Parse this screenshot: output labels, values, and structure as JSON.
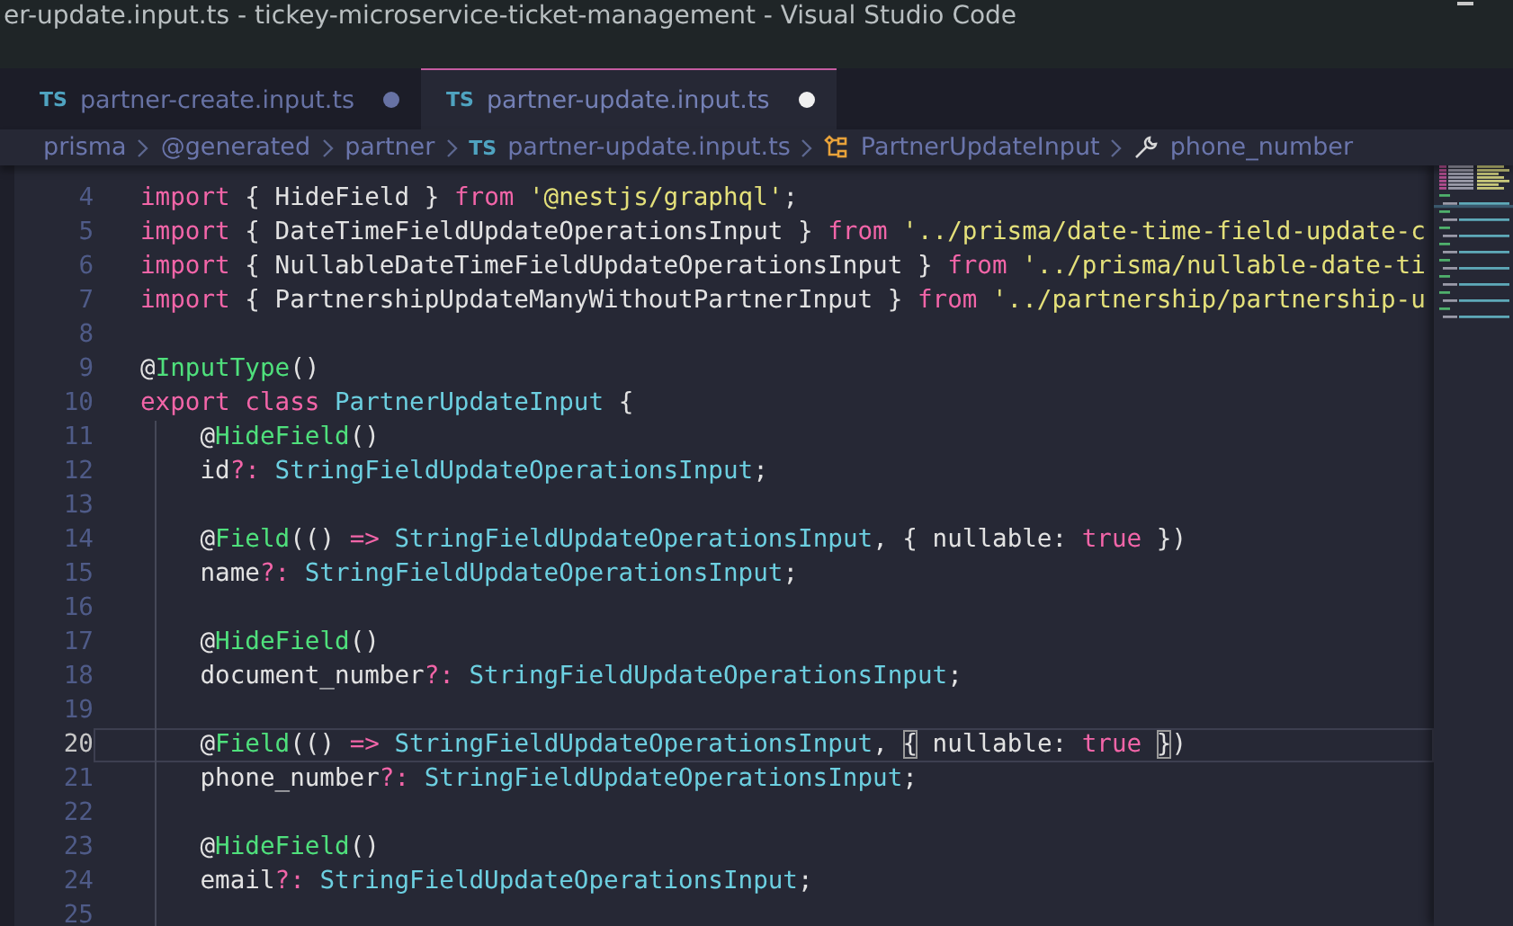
{
  "window": {
    "title": "er-update.input.ts - tickey-microservice-ticket-management - Visual Studio Code"
  },
  "tabs": [
    {
      "label": "partner-create.input.ts",
      "badge": "TS",
      "selected": false,
      "modified": true
    },
    {
      "label": "partner-update.input.ts",
      "badge": "TS",
      "selected": true,
      "modified": true
    }
  ],
  "breadcrumbs": [
    {
      "kind": "folder",
      "label": "prisma"
    },
    {
      "kind": "folder",
      "label": "@generated"
    },
    {
      "kind": "folder",
      "label": "partner"
    },
    {
      "kind": "file",
      "label": "partner-update.input.ts",
      "badge": "TS"
    },
    {
      "kind": "class",
      "label": "PartnerUpdateInput"
    },
    {
      "kind": "property",
      "label": "phone_number"
    }
  ],
  "editor": {
    "lines": [
      {
        "number": "4",
        "current": false,
        "tokens": [
          {
            "kind": "keyword",
            "text": "import "
          },
          {
            "kind": "plain",
            "text": "{ HideField } "
          },
          {
            "kind": "keyword",
            "text": "from "
          },
          {
            "kind": "string",
            "text": "'@nestjs/graphql'"
          },
          {
            "kind": "plain",
            "text": ";"
          }
        ]
      },
      {
        "number": "5",
        "current": false,
        "tokens": [
          {
            "kind": "keyword",
            "text": "import "
          },
          {
            "kind": "plain",
            "text": "{ DateTimeFieldUpdateOperationsInput } "
          },
          {
            "kind": "keyword",
            "text": "from "
          },
          {
            "kind": "string",
            "text": "'../prisma/date-time-field-update-c"
          }
        ]
      },
      {
        "number": "6",
        "current": false,
        "tokens": [
          {
            "kind": "keyword",
            "text": "import "
          },
          {
            "kind": "plain",
            "text": "{ NullableDateTimeFieldUpdateOperationsInput } "
          },
          {
            "kind": "keyword",
            "text": "from "
          },
          {
            "kind": "string",
            "text": "'../prisma/nullable-date-ti"
          }
        ]
      },
      {
        "number": "7",
        "current": false,
        "tokens": [
          {
            "kind": "keyword",
            "text": "import "
          },
          {
            "kind": "plain",
            "text": "{ PartnershipUpdateManyWithoutPartnerInput } "
          },
          {
            "kind": "keyword",
            "text": "from "
          },
          {
            "kind": "string",
            "text": "'../partnership/partnership-u"
          }
        ]
      },
      {
        "number": "8",
        "current": false
      },
      {
        "number": "9",
        "current": false,
        "tokens": [
          {
            "kind": "plain",
            "text": "@"
          },
          {
            "kind": "decorator",
            "text": "InputType"
          },
          {
            "kind": "plain",
            "text": "()"
          }
        ]
      },
      {
        "number": "10",
        "current": false,
        "tokens": [
          {
            "kind": "keyword",
            "text": "export class "
          },
          {
            "kind": "type",
            "text": "PartnerUpdateInput"
          },
          {
            "kind": "plain",
            "text": " {"
          }
        ]
      },
      {
        "number": "11",
        "current": false,
        "tokens": [
          {
            "kind": "plain",
            "text": "    @"
          },
          {
            "kind": "decorator",
            "text": "HideField"
          },
          {
            "kind": "plain",
            "text": "()"
          }
        ]
      },
      {
        "number": "12",
        "current": false,
        "tokens": [
          {
            "kind": "plain",
            "text": "    id"
          },
          {
            "kind": "keyword",
            "text": "?: "
          },
          {
            "kind": "type",
            "text": "StringFieldUpdateOperationsInput"
          },
          {
            "kind": "plain",
            "text": ";"
          }
        ]
      },
      {
        "number": "13",
        "current": false
      },
      {
        "number": "14",
        "current": false,
        "tokens": [
          {
            "kind": "plain",
            "text": "    @"
          },
          {
            "kind": "decorator",
            "text": "Field"
          },
          {
            "kind": "plain",
            "text": "(() "
          },
          {
            "kind": "keyword",
            "text": "=> "
          },
          {
            "kind": "type",
            "text": "StringFieldUpdateOperationsInput"
          },
          {
            "kind": "plain",
            "text": ", { nullable: "
          },
          {
            "kind": "keyword",
            "text": "true"
          },
          {
            "kind": "plain",
            "text": " })"
          }
        ]
      },
      {
        "number": "15",
        "current": false,
        "tokens": [
          {
            "kind": "plain",
            "text": "    name"
          },
          {
            "kind": "keyword",
            "text": "?: "
          },
          {
            "kind": "type",
            "text": "StringFieldUpdateOperationsInput"
          },
          {
            "kind": "plain",
            "text": ";"
          }
        ]
      },
      {
        "number": "16",
        "current": false
      },
      {
        "number": "17",
        "current": false,
        "tokens": [
          {
            "kind": "plain",
            "text": "    @"
          },
          {
            "kind": "decorator",
            "text": "HideField"
          },
          {
            "kind": "plain",
            "text": "()"
          }
        ]
      },
      {
        "number": "18",
        "current": false,
        "tokens": [
          {
            "kind": "plain",
            "text": "    document_number"
          },
          {
            "kind": "keyword",
            "text": "?: "
          },
          {
            "kind": "type",
            "text": "StringFieldUpdateOperationsInput"
          },
          {
            "kind": "plain",
            "text": ";"
          }
        ]
      },
      {
        "number": "19",
        "current": false
      },
      {
        "number": "20",
        "current": true,
        "tokens": [
          {
            "kind": "plain",
            "text": "    @"
          },
          {
            "kind": "decorator",
            "text": "Field"
          },
          {
            "kind": "plain",
            "text": "(() "
          },
          {
            "kind": "keyword",
            "text": "=> "
          },
          {
            "kind": "type",
            "text": "StringFieldUpdateOperationsInput"
          },
          {
            "kind": "plain",
            "text": ", "
          },
          {
            "kind": "bracket",
            "text": "{"
          },
          {
            "kind": "plain",
            "text": " nullable: "
          },
          {
            "kind": "keyword",
            "text": "true "
          },
          {
            "kind": "bracket",
            "text": "}"
          },
          {
            "kind": "plain",
            "text": ")"
          }
        ]
      },
      {
        "number": "21",
        "current": false,
        "tokens": [
          {
            "kind": "plain",
            "text": "    phone_number"
          },
          {
            "kind": "keyword",
            "text": "?: "
          },
          {
            "kind": "type",
            "text": "StringFieldUpdateOperationsInput"
          },
          {
            "kind": "plain",
            "text": ";"
          }
        ]
      },
      {
        "number": "22",
        "current": false
      },
      {
        "number": "23",
        "current": false,
        "tokens": [
          {
            "kind": "plain",
            "text": "    @"
          },
          {
            "kind": "decorator",
            "text": "HideField"
          },
          {
            "kind": "plain",
            "text": "()"
          }
        ]
      },
      {
        "number": "24",
        "current": false,
        "tokens": [
          {
            "kind": "plain",
            "text": "    email"
          },
          {
            "kind": "keyword",
            "text": "?: "
          },
          {
            "kind": "type",
            "text": "StringFieldUpdateOperationsInput"
          },
          {
            "kind": "plain",
            "text": ";"
          }
        ]
      },
      {
        "number": "25",
        "current": false
      }
    ]
  }
}
